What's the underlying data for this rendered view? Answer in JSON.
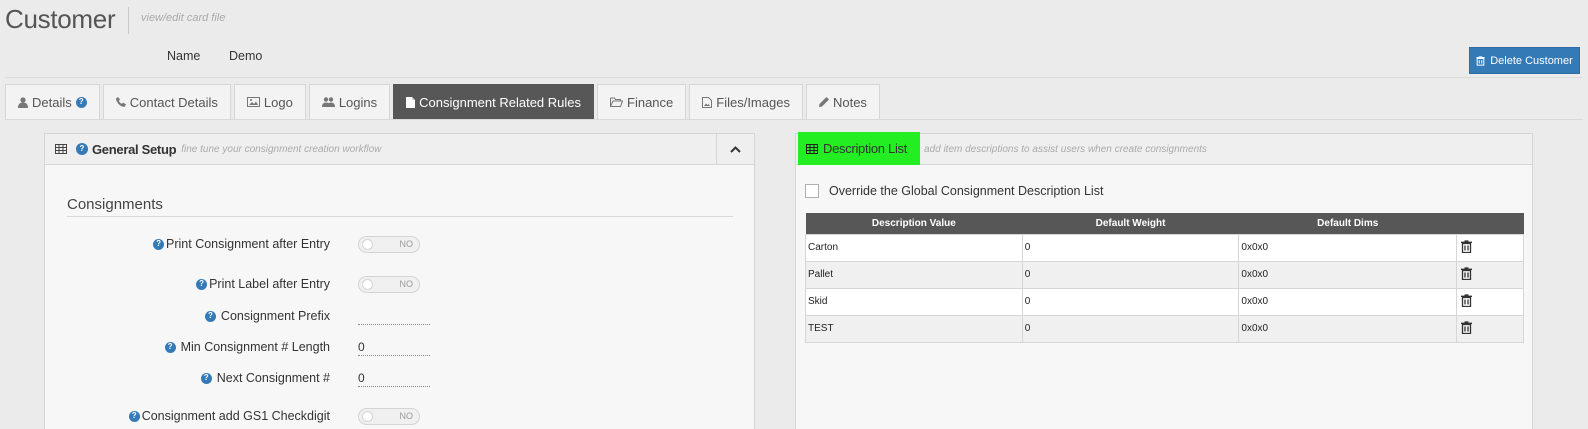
{
  "header": {
    "title": "Customer",
    "subtitle": "view/edit card file",
    "name_label": "Name",
    "name_value": "Demo",
    "delete_label": "Delete Customer"
  },
  "tabs": [
    {
      "label": "Details",
      "icon": "user-icon",
      "active": false
    },
    {
      "label": "Contact Details",
      "icon": "phone-icon",
      "active": false
    },
    {
      "label": "Logo",
      "icon": "image-icon",
      "active": false
    },
    {
      "label": "Logins",
      "icon": "users-icon",
      "active": false
    },
    {
      "label": "Consignment Related Rules",
      "icon": "file-icon",
      "active": true
    },
    {
      "label": "Finance",
      "icon": "folder-open-icon",
      "active": false
    },
    {
      "label": "Files/Images",
      "icon": "file-image-icon",
      "active": false
    },
    {
      "label": "Notes",
      "icon": "pencil-icon",
      "active": false
    }
  ],
  "general_setup": {
    "title": "General Setup",
    "subtitle": "fine tune your consignment creation workflow",
    "section_title": "Consignments",
    "rows": [
      {
        "label": "Print Consignment after Entry",
        "type": "toggle",
        "value": "NO"
      },
      {
        "label": "Print Label after Entry",
        "type": "toggle",
        "value": "NO"
      },
      {
        "label": "Consignment Prefix",
        "type": "editable",
        "value": ""
      },
      {
        "label": "Min Consignment # Length",
        "type": "editable",
        "value": "0"
      },
      {
        "label": "Next Consignment #",
        "type": "editable",
        "value": "0"
      },
      {
        "label": "Consignment add GS1 Checkdigit",
        "type": "toggle",
        "value": "NO"
      }
    ]
  },
  "description_list": {
    "title": "Description List",
    "subtitle": "add item descriptions to assist users when create consignments",
    "override_label": "Override the Global Consignment Description List",
    "columns": [
      "Description Value",
      "Default Weight",
      "Default Dims"
    ],
    "rows": [
      {
        "desc": "Carton",
        "weight": "0",
        "dims": "0x0x0"
      },
      {
        "desc": "Pallet",
        "weight": "0",
        "dims": "0x0x0"
      },
      {
        "desc": "Skid",
        "weight": "0",
        "dims": "0x0x0"
      },
      {
        "desc": "TEST",
        "weight": "0",
        "dims": "0x0x0"
      }
    ]
  },
  "colors": {
    "accent": "#337ab7",
    "tab_active": "#575757",
    "highlight": "#22ee22"
  }
}
